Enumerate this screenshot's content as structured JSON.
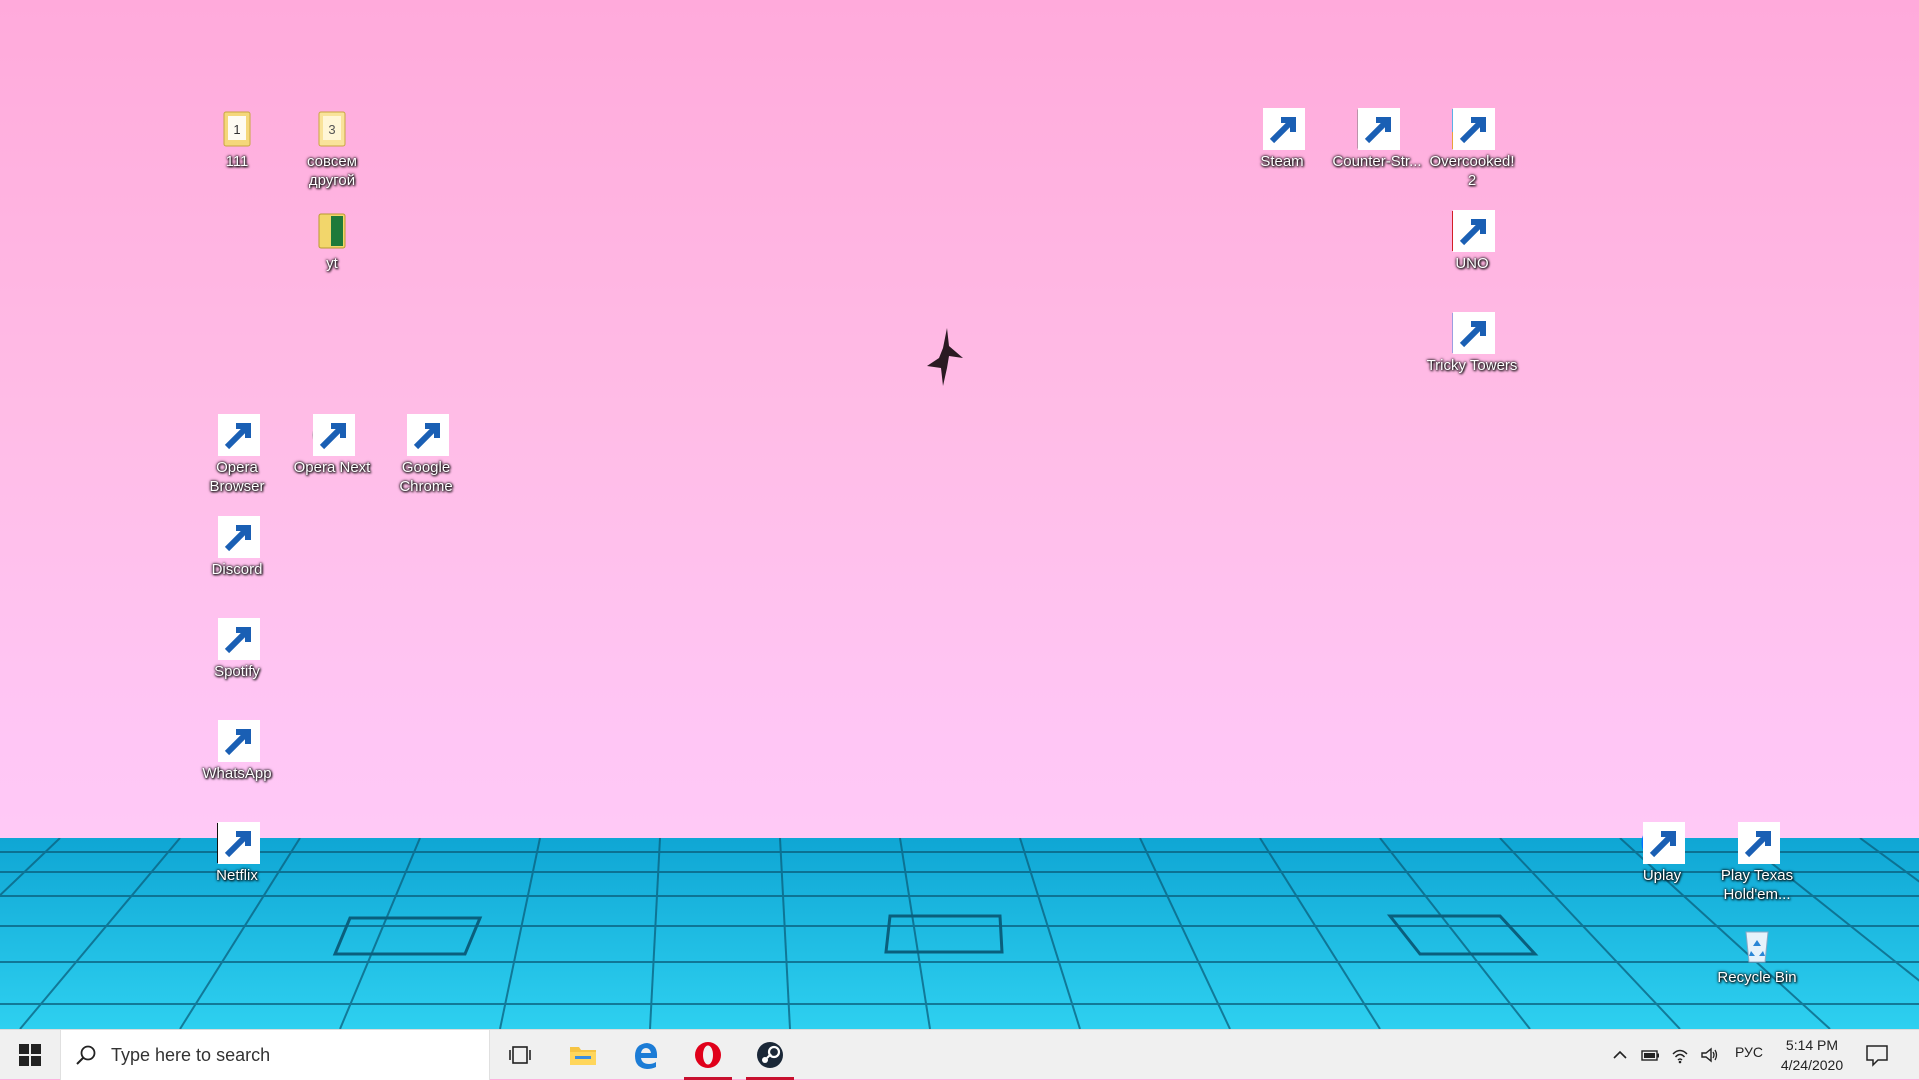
{
  "desktop": {
    "icons_left": [
      {
        "id": "folder-111",
        "label": "111"
      },
      {
        "id": "folder-sovsem",
        "label": "совсем другой"
      },
      {
        "id": "folder-yt",
        "label": "yt"
      },
      {
        "id": "opera-browser",
        "label": "Opera Browser"
      },
      {
        "id": "opera-next",
        "label": "Opera Next"
      },
      {
        "id": "google-chrome",
        "label": "Google Chrome"
      },
      {
        "id": "discord",
        "label": "Discord"
      },
      {
        "id": "spotify",
        "label": "Spotify"
      },
      {
        "id": "whatsapp",
        "label": "WhatsApp"
      },
      {
        "id": "netflix",
        "label": "Netflix"
      }
    ],
    "icons_right": [
      {
        "id": "steam",
        "label": "Steam"
      },
      {
        "id": "counter-strike",
        "label": "Counter-Str..."
      },
      {
        "id": "overcooked",
        "label": "Overcooked! 2"
      },
      {
        "id": "uno",
        "label": "UNO"
      },
      {
        "id": "tricky-towers",
        "label": "Tricky Towers"
      },
      {
        "id": "uplay",
        "label": "Uplay"
      },
      {
        "id": "texas-holdem",
        "label": "Play Texas Hold'em..."
      },
      {
        "id": "recycle-bin",
        "label": "Recycle Bin"
      }
    ],
    "folder_111_badge": "1",
    "folder_sovsem_badge": "3"
  },
  "taskbar": {
    "search_placeholder": "Type here to search",
    "pinned": [
      "task-view",
      "file-explorer",
      "edge",
      "opera",
      "steam"
    ],
    "tray": {
      "language": "РУС",
      "time": "5:14 PM",
      "date": "4/24/2020"
    }
  },
  "colors": {
    "sky_top": "#ffaadb",
    "sky_bottom": "#ffd0f8",
    "roof": "#1ab3dc",
    "taskbar": "#f0f0f0",
    "opera_red": "#e0001a"
  }
}
